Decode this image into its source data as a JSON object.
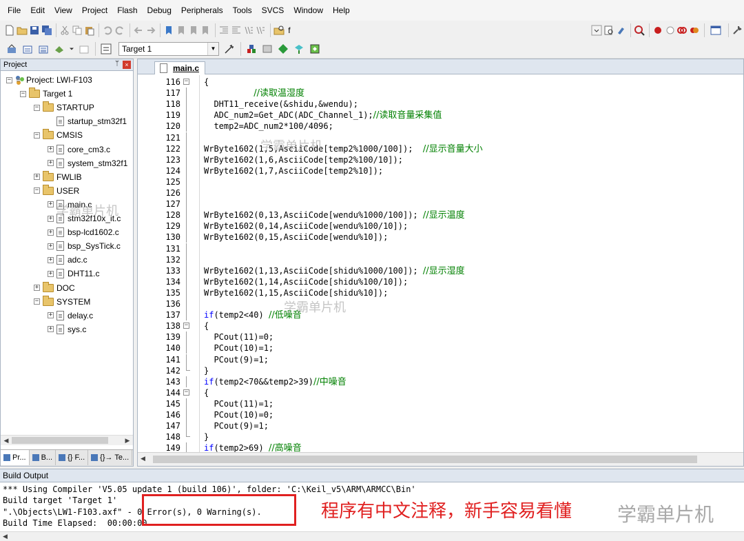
{
  "menu": [
    "File",
    "Edit",
    "View",
    "Project",
    "Flash",
    "Debug",
    "Peripherals",
    "Tools",
    "SVCS",
    "Window",
    "Help"
  ],
  "toolbar": {
    "find_combo_value": "f",
    "target_combo_value": "Target 1"
  },
  "project_panel": {
    "title": "Project",
    "pin_glyph": "ᛘ",
    "close_glyph": "×",
    "tree": [
      {
        "label": "Project: LWI-F103",
        "level": 0,
        "kind": "project",
        "expander": "−"
      },
      {
        "label": "Target 1",
        "level": 1,
        "kind": "target",
        "expander": "−"
      },
      {
        "label": "STARTUP",
        "level": 2,
        "kind": "folder",
        "expander": "−"
      },
      {
        "label": "startup_stm32f1",
        "level": 3,
        "kind": "file",
        "expander": ""
      },
      {
        "label": "CMSIS",
        "level": 2,
        "kind": "folder",
        "expander": "−"
      },
      {
        "label": "core_cm3.c",
        "level": 3,
        "kind": "file",
        "expander": "+"
      },
      {
        "label": "system_stm32f1",
        "level": 3,
        "kind": "file",
        "expander": "+"
      },
      {
        "label": "FWLIB",
        "level": 2,
        "kind": "folder",
        "expander": "+"
      },
      {
        "label": "USER",
        "level": 2,
        "kind": "folder",
        "expander": "−"
      },
      {
        "label": "main.c",
        "level": 3,
        "kind": "file",
        "expander": "+"
      },
      {
        "label": "stm32f10x_it.c",
        "level": 3,
        "kind": "file",
        "expander": "+"
      },
      {
        "label": "bsp-lcd1602.c",
        "level": 3,
        "kind": "file",
        "expander": "+"
      },
      {
        "label": "bsp_SysTick.c",
        "level": 3,
        "kind": "file",
        "expander": "+"
      },
      {
        "label": "adc.c",
        "level": 3,
        "kind": "file",
        "expander": "+"
      },
      {
        "label": "DHT11.c",
        "level": 3,
        "kind": "file",
        "expander": "+"
      },
      {
        "label": "DOC",
        "level": 2,
        "kind": "folder",
        "expander": "+"
      },
      {
        "label": "SYSTEM",
        "level": 2,
        "kind": "folder",
        "expander": "−"
      },
      {
        "label": "delay.c",
        "level": 3,
        "kind": "file",
        "expander": "+"
      },
      {
        "label": "sys.c",
        "level": 3,
        "kind": "file",
        "expander": "+"
      }
    ],
    "tabs": [
      "Pr...",
      "B...",
      "{} F...",
      "{}→ Te..."
    ]
  },
  "editor": {
    "file_tab": "main.c",
    "lines": [
      {
        "n": "116",
        "fold": "open",
        "segs": [
          {
            "t": "{",
            "c": ""
          }
        ]
      },
      {
        "n": "117",
        "fold": "line",
        "segs": [
          {
            "t": "          ",
            "c": ""
          },
          {
            "t": "//读取温湿度",
            "c": "cm"
          }
        ]
      },
      {
        "n": "118",
        "fold": "line",
        "segs": [
          {
            "t": "  DHT11_receive(&shidu,&wendu);",
            "c": ""
          }
        ]
      },
      {
        "n": "119",
        "fold": "line",
        "segs": [
          {
            "t": "  ADC_num2=Get_ADC(ADC_Channel_1);",
            "c": ""
          },
          {
            "t": "//读取音量采集值",
            "c": "cm"
          }
        ]
      },
      {
        "n": "120",
        "fold": "line",
        "segs": [
          {
            "t": "  temp2=ADC_num2*100/4096;",
            "c": ""
          }
        ]
      },
      {
        "n": "121",
        "fold": "line",
        "segs": []
      },
      {
        "n": "122",
        "fold": "line",
        "segs": [
          {
            "t": "WrByte1602(1,5,AsciiCode[temp2%1000/100]);  ",
            "c": ""
          },
          {
            "t": "//显示音量大小",
            "c": "cm"
          }
        ]
      },
      {
        "n": "123",
        "fold": "line",
        "segs": [
          {
            "t": "WrByte1602(1,6,AsciiCode[temp2%100/10]);",
            "c": ""
          }
        ]
      },
      {
        "n": "124",
        "fold": "line",
        "segs": [
          {
            "t": "WrByte1602(1,7,AsciiCode[temp2%10]);",
            "c": ""
          }
        ]
      },
      {
        "n": "125",
        "fold": "line",
        "segs": []
      },
      {
        "n": "126",
        "fold": "line",
        "segs": []
      },
      {
        "n": "127",
        "fold": "line",
        "segs": []
      },
      {
        "n": "128",
        "fold": "line",
        "segs": [
          {
            "t": "WrByte1602(0,13,AsciiCode[wendu%1000/100]); ",
            "c": ""
          },
          {
            "t": "//显示温度",
            "c": "cm"
          }
        ]
      },
      {
        "n": "129",
        "fold": "line",
        "segs": [
          {
            "t": "WrByte1602(0,14,AsciiCode[wendu%100/10]);",
            "c": ""
          }
        ]
      },
      {
        "n": "130",
        "fold": "line",
        "segs": [
          {
            "t": "WrByte1602(0,15,AsciiCode[wendu%10]);",
            "c": ""
          }
        ]
      },
      {
        "n": "131",
        "fold": "line",
        "segs": []
      },
      {
        "n": "132",
        "fold": "line",
        "segs": []
      },
      {
        "n": "133",
        "fold": "line",
        "segs": [
          {
            "t": "WrByte1602(1,13,AsciiCode[shidu%1000/100]); ",
            "c": ""
          },
          {
            "t": "//显示湿度",
            "c": "cm"
          }
        ]
      },
      {
        "n": "134",
        "fold": "line",
        "segs": [
          {
            "t": "WrByte1602(1,14,AsciiCode[shidu%100/10]);",
            "c": ""
          }
        ]
      },
      {
        "n": "135",
        "fold": "line",
        "segs": [
          {
            "t": "WrByte1602(1,15,AsciiCode[shidu%10]);",
            "c": ""
          }
        ]
      },
      {
        "n": "136",
        "fold": "line",
        "segs": []
      },
      {
        "n": "137",
        "fold": "line",
        "segs": [
          {
            "t": "if",
            "c": "kw"
          },
          {
            "t": "(temp2<40) ",
            "c": ""
          },
          {
            "t": "//低噪音",
            "c": "cm"
          }
        ]
      },
      {
        "n": "138",
        "fold": "open",
        "segs": [
          {
            "t": "{",
            "c": ""
          }
        ]
      },
      {
        "n": "139",
        "fold": "line",
        "segs": [
          {
            "t": "  PCout(11)=0;",
            "c": ""
          }
        ]
      },
      {
        "n": "140",
        "fold": "line",
        "segs": [
          {
            "t": "  PCout(10)=1;",
            "c": ""
          }
        ]
      },
      {
        "n": "141",
        "fold": "line",
        "segs": [
          {
            "t": "  PCout(9)=1;",
            "c": ""
          }
        ]
      },
      {
        "n": "142",
        "fold": "end",
        "segs": [
          {
            "t": "}",
            "c": ""
          }
        ]
      },
      {
        "n": "143",
        "fold": "line",
        "segs": [
          {
            "t": "if",
            "c": "kw"
          },
          {
            "t": "(temp2<70&&temp2>39)",
            "c": ""
          },
          {
            "t": "//中噪音",
            "c": "cm"
          }
        ]
      },
      {
        "n": "144",
        "fold": "open",
        "segs": [
          {
            "t": "{",
            "c": ""
          }
        ]
      },
      {
        "n": "145",
        "fold": "line",
        "segs": [
          {
            "t": "  PCout(11)=1;",
            "c": ""
          }
        ]
      },
      {
        "n": "146",
        "fold": "line",
        "segs": [
          {
            "t": "  PCout(10)=0;",
            "c": ""
          }
        ]
      },
      {
        "n": "147",
        "fold": "line",
        "segs": [
          {
            "t": "  PCout(9)=1;",
            "c": ""
          }
        ]
      },
      {
        "n": "148",
        "fold": "end",
        "segs": [
          {
            "t": "}",
            "c": ""
          }
        ]
      },
      {
        "n": "149",
        "fold": "line",
        "segs": [
          {
            "t": "if",
            "c": "kw"
          },
          {
            "t": "(temp2>69) ",
            "c": ""
          },
          {
            "t": "//高噪音",
            "c": "cm"
          }
        ]
      }
    ]
  },
  "build_output": {
    "title": "Build Output",
    "lines": [
      "*** Using Compiler 'V5.05 update 1 (build 106)', folder: 'C:\\Keil_v5\\ARM\\ARMCC\\Bin'",
      "Build target 'Target 1'",
      "\".\\Objects\\LW1-F103.axf\" - 0 Error(s), 0 Warning(s).",
      "Build Time Elapsed:  00:00:00"
    ]
  },
  "annotation": "程序有中文注释，新手容易看懂",
  "watermark": "学霸单片机",
  "colors": {
    "comment": "#008000",
    "keyword": "#0000ff",
    "annotation_red": "#e02020",
    "panel_header": "#dfe6ef"
  }
}
